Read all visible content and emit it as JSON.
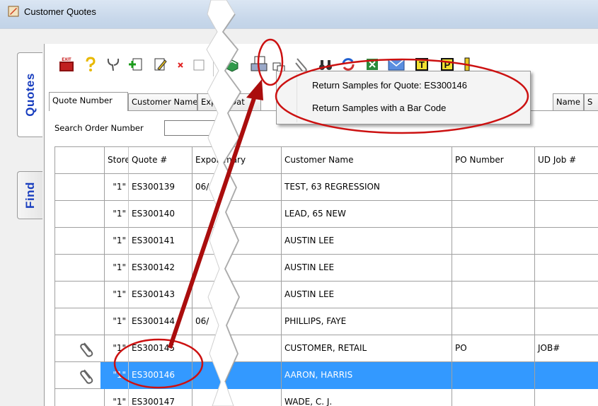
{
  "window": {
    "title": "Customer Quotes"
  },
  "side_tabs": [
    {
      "label": "Quotes"
    },
    {
      "label": "Find"
    }
  ],
  "toolbar": {
    "icons": [
      "exit-icon",
      "help-icon",
      "tools-icon",
      "add-icon",
      "edit-icon",
      "delete-icon",
      "blank-icon",
      "return-samples-icon",
      "print-icon",
      "copy-icon",
      "attach-icon",
      "binoculars-icon",
      "refresh-icon",
      "excel-icon",
      "email-icon",
      "t-icon",
      "p-icon"
    ],
    "exit_label": "EXIT",
    "t_label": "T",
    "p_label": "P"
  },
  "sort_tabs": [
    {
      "label": "Quote Number"
    },
    {
      "label": "Customer Name"
    },
    {
      "label": "Export Dat"
    },
    {
      "label": "Name"
    }
  ],
  "search": {
    "label": "Search Order Number",
    "value": ""
  },
  "grid": {
    "columns": [
      "Store",
      "Quote #",
      "Expor",
      "mary",
      "Customer Name",
      "PO Number",
      "UD Job #"
    ],
    "rows": [
      {
        "store": "\"1\"",
        "quote": "ES300139",
        "export": "06/(",
        "customer": "TEST, 63 REGRESSION",
        "po": "",
        "ud": "",
        "attach": false,
        "selected": false
      },
      {
        "store": "\"1\"",
        "quote": "ES300140",
        "export": "",
        "customer": "LEAD, 65 NEW",
        "po": "",
        "ud": "",
        "attach": false,
        "selected": false
      },
      {
        "store": "\"1\"",
        "quote": "ES300141",
        "export": "",
        "customer": "AUSTIN LEE",
        "po": "",
        "ud": "",
        "attach": false,
        "selected": false
      },
      {
        "store": "\"1\"",
        "quote": "ES300142",
        "export": "",
        "customer": "AUSTIN LEE",
        "po": "",
        "ud": "",
        "attach": false,
        "selected": false
      },
      {
        "store": "\"1\"",
        "quote": "ES300143",
        "export": "",
        "customer": "AUSTIN LEE",
        "po": "",
        "ud": "",
        "attach": false,
        "selected": false
      },
      {
        "store": "\"1\"",
        "quote": "ES300144",
        "export": "06/",
        "customer": "PHILLIPS, FAYE",
        "po": "",
        "ud": "",
        "attach": false,
        "selected": false
      },
      {
        "store": "\"1\"",
        "quote": "ES300145",
        "export": "",
        "customer": "CUSTOMER, RETAIL",
        "po": "PO",
        "ud": "JOB#",
        "attach": true,
        "selected": false
      },
      {
        "store": "\"1\"",
        "quote": "ES300146",
        "export": "",
        "customer": "AARON, HARRIS",
        "po": "",
        "ud": "",
        "attach": true,
        "selected": true
      },
      {
        "store": "\"1\"",
        "quote": "ES300147",
        "export": "",
        "customer": "WADE, C. J.",
        "po": "",
        "ud": "",
        "attach": false,
        "selected": false
      }
    ]
  },
  "context_menu": {
    "items": [
      {
        "label": "Return Samples for Quote: ES300146"
      },
      {
        "label": "Return Samples with a Bar Code"
      }
    ]
  },
  "colors": {
    "selection": "#3399ff",
    "annotation": "#cc1111",
    "tab_text": "#1a3fbf"
  }
}
